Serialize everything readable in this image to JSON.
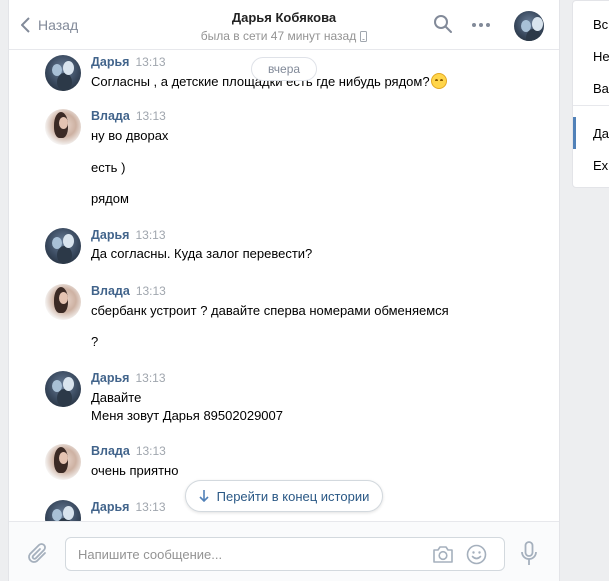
{
  "header": {
    "back_label": "Назад",
    "peer_name": "Дарья Кобякова",
    "peer_status": "была в сети 47 минут назад"
  },
  "date_divider": "вчера",
  "messages": [
    {
      "author": "Дарья",
      "time": "13:13",
      "lines": [
        "Согласны , а детские площадки есть где нибудь рядом?"
      ],
      "has_emoji": true
    },
    {
      "author": "Влада",
      "time": "13:13",
      "lines": [
        "ну во дворах",
        "есть )",
        "рядом"
      ]
    },
    {
      "author": "Дарья",
      "time": "13:13",
      "lines": [
        "Да согласны. Куда залог перевести?"
      ]
    },
    {
      "author": "Влада",
      "time": "13:13",
      "lines": [
        "сбербанк устроит ? давайте сперва номерами обменяемся",
        "?"
      ]
    },
    {
      "author": "Дарья",
      "time": "13:13",
      "lines": [
        "Давайте",
        "Меня зовут Дарья 89502029007"
      ]
    },
    {
      "author": "Влада",
      "time": "13:13",
      "lines": [
        "очень приятно"
      ]
    },
    {
      "author": "Дарья",
      "time": "13:13",
      "lines": []
    }
  ],
  "scroll_to_end_label": "Перейти в конец истории",
  "composer": {
    "placeholder": "Напишите сообщение..."
  },
  "right_panel": {
    "items": [
      "Вс",
      "Не",
      "Ва",
      "Да",
      "Ex"
    ],
    "active_index": 3,
    "accent": "#5181b8"
  },
  "colors": {
    "author": "#42648b",
    "link": "#2a5885",
    "muted": "#939393"
  },
  "icons": [
    "chevron-left-icon",
    "phone-icon",
    "search-icon",
    "more-icon",
    "paperclip-icon",
    "camera-icon",
    "emoji-icon",
    "microphone-icon",
    "arrow-down-icon"
  ]
}
